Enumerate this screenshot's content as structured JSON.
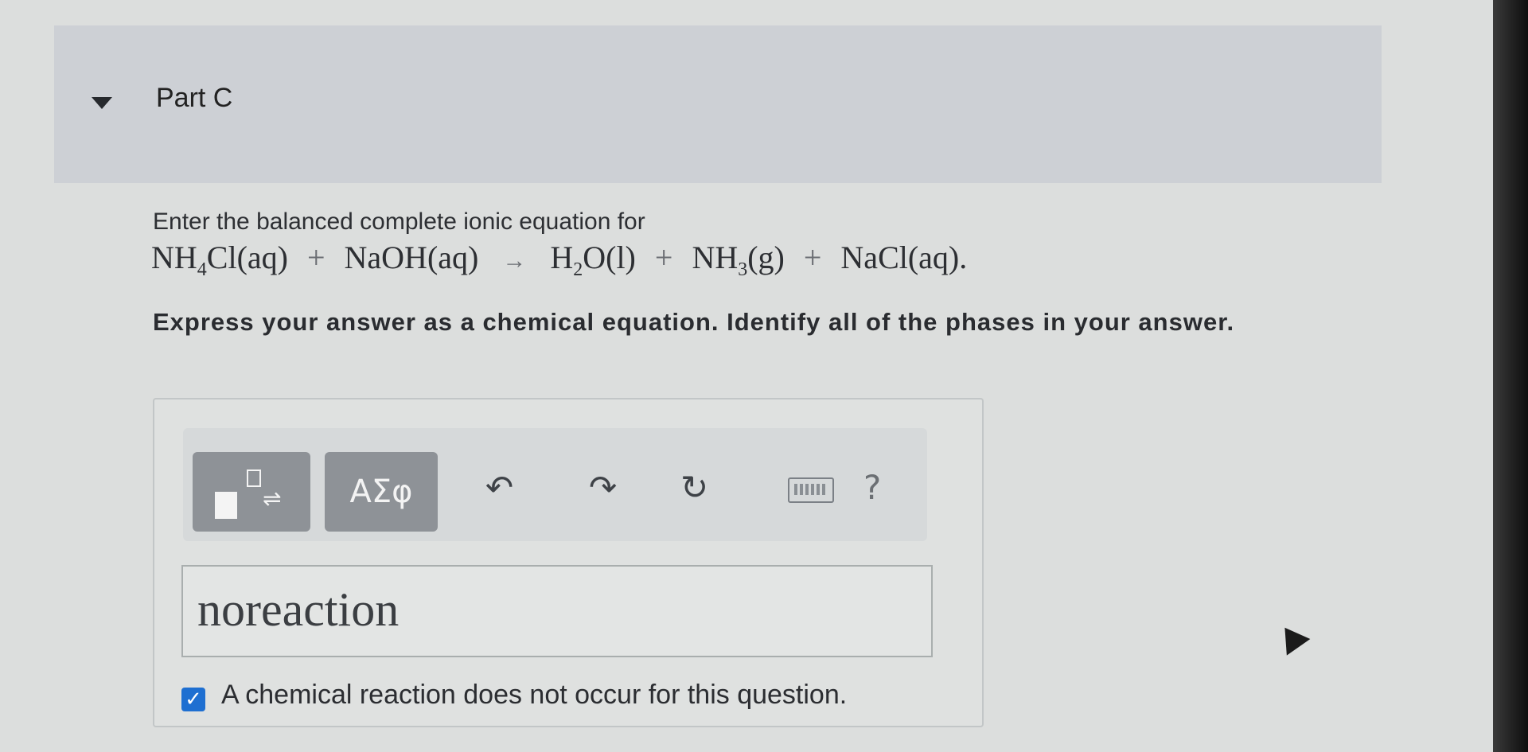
{
  "part": {
    "title": "Part C"
  },
  "question": {
    "prompt": "Enter the balanced complete ionic equation for",
    "equation": {
      "reactant1_a": "NH",
      "reactant1_sub": "4",
      "reactant1_b": "Cl(aq)",
      "plus1": "+",
      "reactant2": "NaOH(aq)",
      "arrow": "→",
      "product1_a": "H",
      "product1_sub": "2",
      "product1_b": "O(l)",
      "plus2": "+",
      "product2_a": "NH",
      "product2_sub": "3",
      "product2_b": "(g)",
      "plus3": "+",
      "product3": "NaCl(aq).",
      "period": ""
    },
    "instructions": "Express your answer as a chemical equation. Identify all of the phases in your answer."
  },
  "toolbar": {
    "greek_label": "ΑΣφ",
    "undo_icon": "undo-icon",
    "redo_icon": "redo-icon",
    "reset_icon": "reset-icon",
    "keyboard_icon": "keyboard-icon",
    "help_label": "?"
  },
  "answer": {
    "value": "noreaction"
  },
  "no_reaction": {
    "checked": true,
    "label": "A chemical reaction does not occur for this question."
  }
}
